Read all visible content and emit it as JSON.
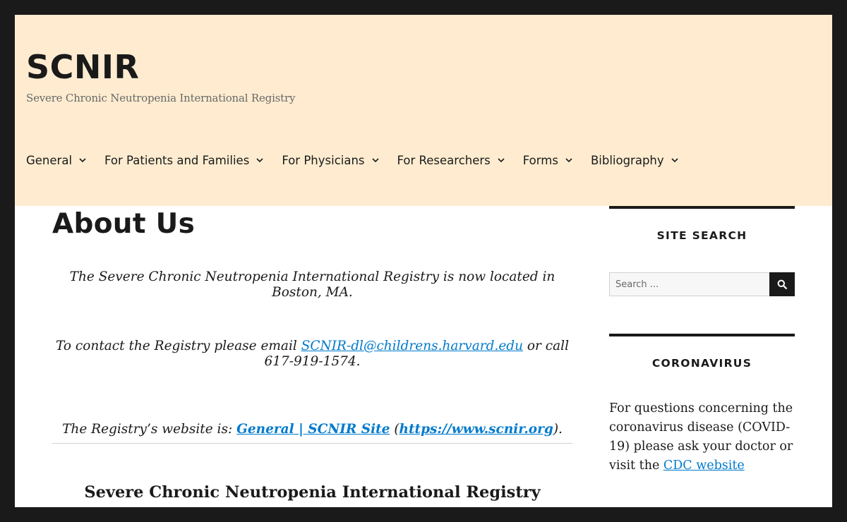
{
  "site": {
    "title": "SCNIR",
    "description": "Severe Chronic Neutropenia International Registry"
  },
  "nav": {
    "items": [
      {
        "label": "General",
        "icon": "chevron-down-icon"
      },
      {
        "label": "For Patients and Families",
        "icon": "chevron-down-icon"
      },
      {
        "label": "For Physicians",
        "icon": "chevron-down-icon"
      },
      {
        "label": "For Researchers",
        "icon": "chevron-down-icon"
      },
      {
        "label": "Forms",
        "icon": "chevron-down-icon"
      },
      {
        "label": "Bibliography",
        "icon": "chevron-down-icon"
      }
    ]
  },
  "main": {
    "title": "About Us",
    "p1": "The Severe Chronic Neutropenia International Registry is now located in Boston, MA.",
    "p2_before": "To contact the Registry please email ",
    "p2_link": "SCNIR-dl@childrens.harvard.edu",
    "p2_after": " or call 617-919-1574.",
    "p3_before": "The Registry’s website is: ",
    "p3_link1": "General | SCNIR Site",
    "p3_mid": " (",
    "p3_link2": "https://www.scnir.org",
    "p3_after": ").",
    "subheading": "Severe Chronic Neutropenia International Registry"
  },
  "sidebar": {
    "search_title": "SITE SEARCH",
    "search_placeholder": "Search ...",
    "search_icon": "search-icon",
    "corona_title": "CORONAVIRUS",
    "corona_text": "For questions concerning the coronavirus disease (COVID-19) please ask your doctor or visit the ",
    "corona_link": "CDC website"
  },
  "colors": {
    "header_bg": "#ffecd0",
    "link": "#007acc",
    "frame": "#1a1a1a"
  }
}
